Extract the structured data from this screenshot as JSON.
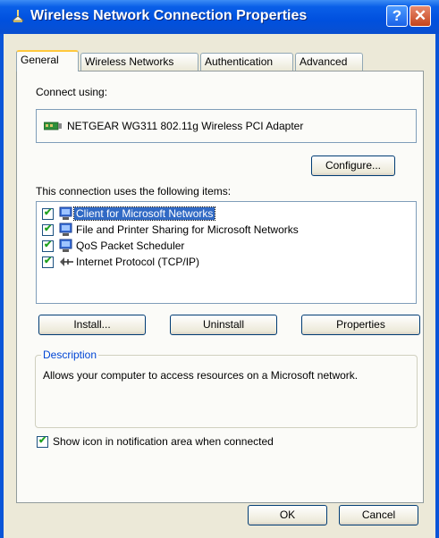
{
  "window": {
    "title": "Wireless Network Connection Properties",
    "icon": "network-connection-icon",
    "help_label": "?",
    "close_label": "✕"
  },
  "tabs": [
    {
      "label": "General",
      "active": true
    },
    {
      "label": "Wireless Networks",
      "active": false
    },
    {
      "label": "Authentication",
      "active": false
    },
    {
      "label": "Advanced",
      "active": false
    }
  ],
  "general": {
    "connect_using_label": "Connect using:",
    "adapter_name": "NETGEAR WG311 802.11g Wireless PCI Adapter",
    "configure_label": "Configure...",
    "items_label": "This connection uses the following items:",
    "items": [
      {
        "label": "Client for Microsoft Networks",
        "checked": true,
        "selected": true,
        "icon": "network-client-icon"
      },
      {
        "label": "File and Printer Sharing for Microsoft Networks",
        "checked": true,
        "selected": false,
        "icon": "file-printer-sharing-icon"
      },
      {
        "label": "QoS Packet Scheduler",
        "checked": true,
        "selected": false,
        "icon": "qos-scheduler-icon"
      },
      {
        "label": "Internet Protocol (TCP/IP)",
        "checked": true,
        "selected": false,
        "icon": "protocol-icon"
      }
    ],
    "install_label": "Install...",
    "uninstall_label": "Uninstall",
    "properties_label": "Properties",
    "description_title": "Description",
    "description_text": "Allows your computer to access resources on a Microsoft network.",
    "show_icon_label": "Show icon in notification area when connected",
    "show_icon_checked": true
  },
  "footer": {
    "ok_label": "OK",
    "cancel_label": "Cancel"
  },
  "colors": {
    "titlebar": "#0a5fe8",
    "dialog_bg": "#ece9d8",
    "selection": "#316ac5",
    "group_title": "#0046d5"
  }
}
